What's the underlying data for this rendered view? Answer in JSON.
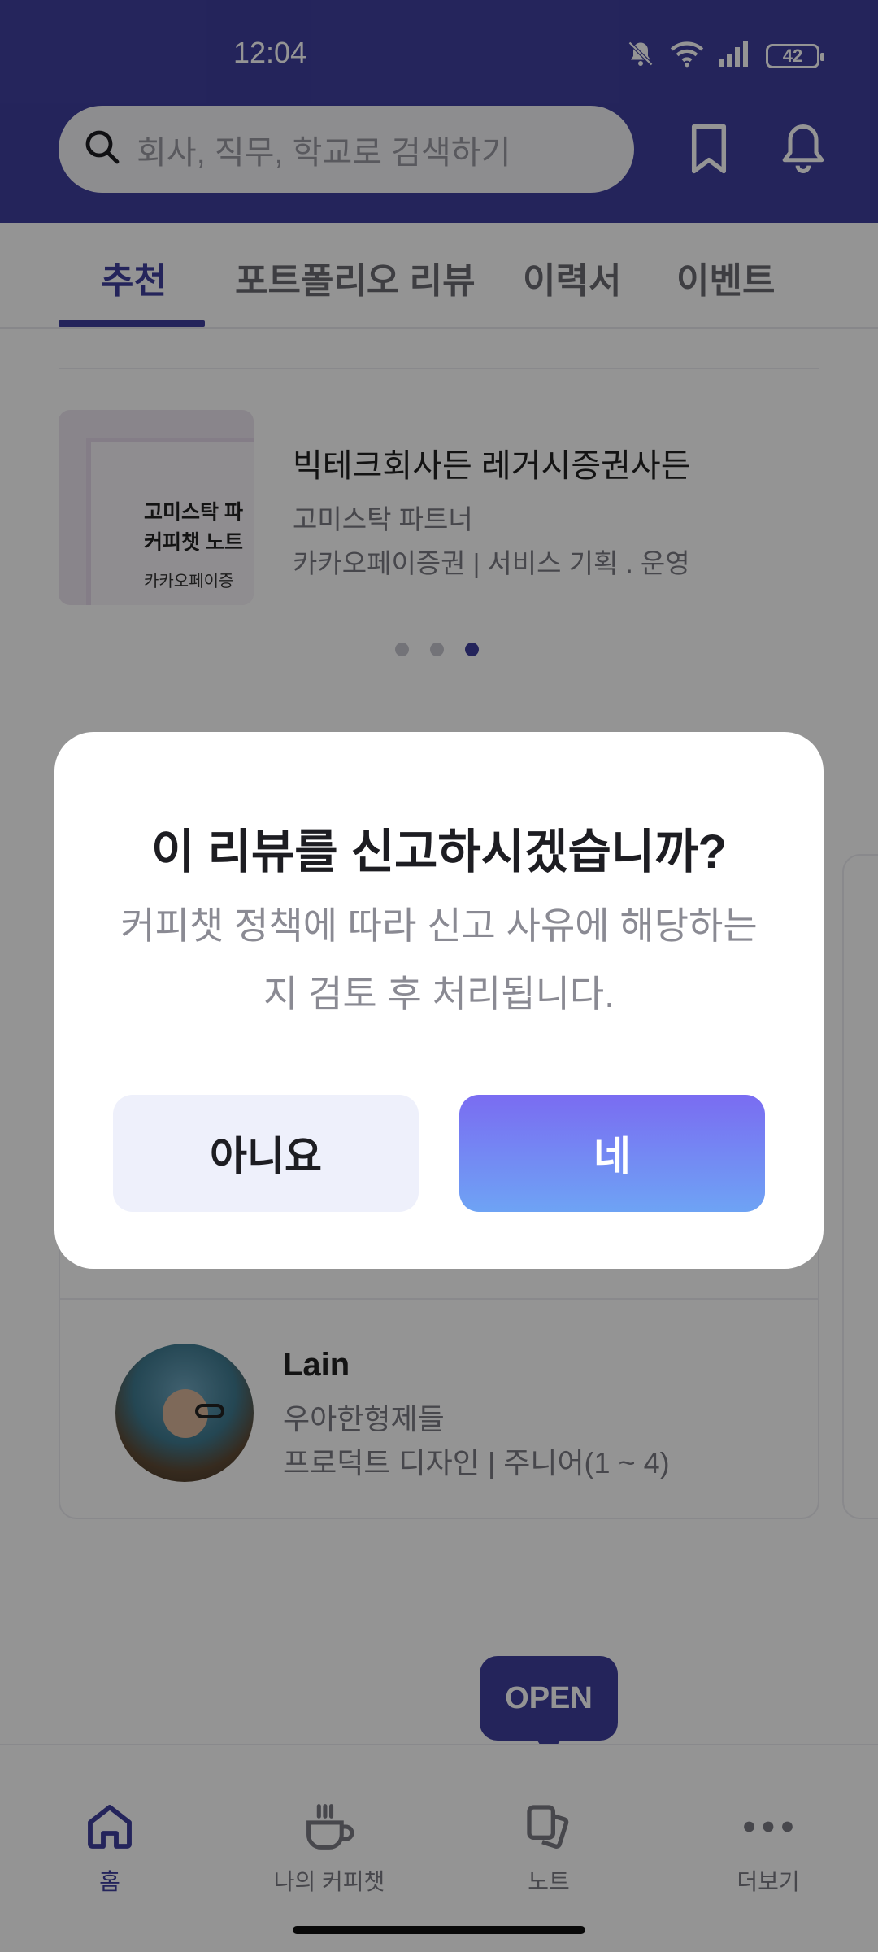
{
  "status_bar": {
    "time": "12:04",
    "battery": "42"
  },
  "search": {
    "placeholder": "회사, 직무, 학교로 검색하기"
  },
  "tabs": [
    {
      "label": "추천",
      "active": true
    },
    {
      "label": "포트폴리오 리뷰"
    },
    {
      "label": "이력서"
    },
    {
      "label": "이벤트"
    }
  ],
  "card": {
    "thumb_line1": "고미스탁 파",
    "thumb_line2": "커피챗 노트",
    "thumb_line3": "카카오페이증",
    "title": "빅테크회사든 레거시증권사든",
    "author": "고미스탁 파트너",
    "meta": "카카오페이증권 | 서비스 기획 . 운영"
  },
  "carousel": {
    "count": 3,
    "active_index": 2
  },
  "mentor": {
    "name": "Lain",
    "company": "우아한형제들",
    "role": "프로덕트 디자인 | 주니어(1 ~ 4)"
  },
  "open_badge": "OPEN",
  "bottom_nav": [
    {
      "label": "홈",
      "icon": "home-icon",
      "active": true
    },
    {
      "label": "나의 커피챗",
      "icon": "coffee-cup-icon"
    },
    {
      "label": "노트",
      "icon": "notes-icon"
    },
    {
      "label": "더보기",
      "icon": "more-dots-icon"
    }
  ],
  "dialog": {
    "title": "이 리뷰를 신고하시겠습니까?",
    "message": "커피챗 정책에 따라 신고 사유에 해당하는지 검토 후 처리됩니다.",
    "cancel_label": "아니요",
    "confirm_label": "네"
  },
  "colors": {
    "brand": "#3f3f9e",
    "dialog_confirm_gradient_top": "#7a6cf2",
    "dialog_confirm_gradient_bottom": "#6ea3f4",
    "dialog_cancel_bg": "#eef0fb"
  }
}
